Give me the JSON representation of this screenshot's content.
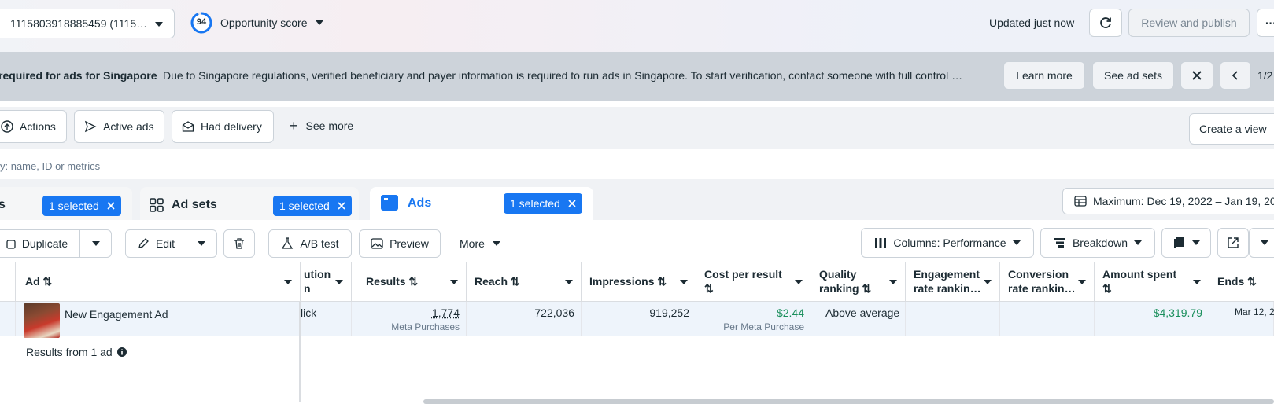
{
  "topbar": {
    "account_label": "1115803918885459 (1115…",
    "score_value": "94",
    "score_label": "Opportunity score",
    "updated_text": "Updated just now",
    "review_publish_label": "Review and publish",
    "more_label": "···"
  },
  "banner": {
    "title": "required for ads for Singapore",
    "message": "Due to Singapore regulations, verified beneficiary and payer information is required to run ads in Singapore. To start verification, contact someone with full control …",
    "learn_more_label": "Learn more",
    "see_ad_sets_label": "See ad sets",
    "page_indicator": "1/2"
  },
  "filters": {
    "actions_label": "Actions",
    "active_ads_label": "Active ads",
    "had_delivery_label": "Had delivery",
    "see_more_label": "See more",
    "create_view_label": "Create a view"
  },
  "search": {
    "placeholder_text": "y: name, ID or metrics"
  },
  "tabs": {
    "campaigns_label": "s",
    "campaigns_selected": "1 selected",
    "adsets_label": "Ad sets",
    "adsets_selected": "1 selected",
    "ads_label": "Ads",
    "ads_selected": "1 selected",
    "date_range": "Maximum: Dec 19, 2022 – Jan 19, 20"
  },
  "toolbar": {
    "duplicate_label": "Duplicate",
    "edit_label": "Edit",
    "ab_test_label": "A/B test",
    "preview_label": "Preview",
    "more_label": "More",
    "columns_label": "Columns: Performance",
    "breakdown_label": "Breakdown"
  },
  "table": {
    "headers": {
      "ad": "Ad ⇅",
      "attribution_l1": "ution",
      "attribution_l2": "n",
      "results": "Results ⇅",
      "reach": "Reach ⇅",
      "impressions": "Impressions ⇅",
      "cost_l1": "Cost per result",
      "cost_l2": "⇅",
      "quality_l1": "Quality",
      "quality_l2": "ranking ⇅",
      "engagement_l1": "Engagement",
      "engagement_l2": "rate rankin…",
      "conversion_l1": "Conversion",
      "conversion_l2": "rate rankin…",
      "amount_l1": "Amount spent",
      "amount_l2": "⇅",
      "ends": "Ends ⇅"
    },
    "row": {
      "ad_name": "New Engagement Ad",
      "attribution": "lick",
      "results": "1,774",
      "results_sub": "Meta Purchases",
      "reach": "722,036",
      "impressions": "919,252",
      "cost": "$2.44",
      "cost_sub": "Per Meta Purchase",
      "quality": "Above average",
      "engagement": "—",
      "conversion": "—",
      "amount": "$4,319.79",
      "ends": "Mar 12, 2"
    },
    "footer_text": "Results from 1 ad"
  },
  "colors": {
    "accent": "#1877f2",
    "green": "#1a8f5c",
    "banner": "#cdd3da"
  }
}
